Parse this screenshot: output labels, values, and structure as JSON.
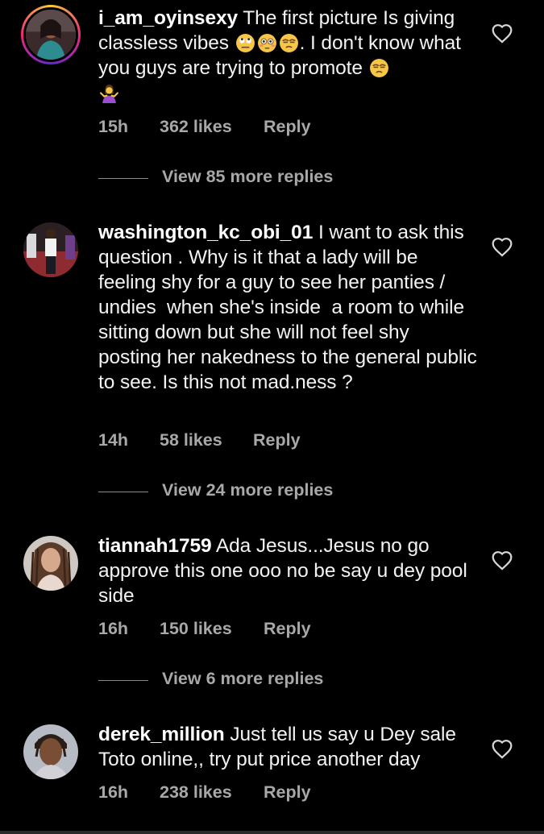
{
  "comments": [
    {
      "username": "i_am_oyinsexy",
      "text_part1": " The first picture Is giving classless vibes ",
      "text_part2": ". I don't know what you guys are trying to promote ",
      "emojis": [
        "eye-roll-emoji",
        "flushed-emoji",
        "unamused-emoji",
        "unamused-emoji",
        "woman-shrugging-emoji"
      ],
      "time": "15h",
      "likes": "362 likes",
      "reply_label": "Reply",
      "view_replies": "View 85 more replies"
    },
    {
      "username": "washington_kc_obi_01",
      "text": " I want to ask this question . Why is it that a lady will be feeling shy for a guy to see her panties / undies  when she's inside  a room to while sitting down but she will not feel shy posting her nakedness to the general public to see. Is this not mad.ness ?",
      "time": "14h",
      "likes": "58 likes",
      "reply_label": "Reply",
      "view_replies": "View 24 more replies"
    },
    {
      "username": "tiannah1759",
      "text": " Ada Jesus...Jesus no go approve this one ooo no be say u dey pool side",
      "time": "16h",
      "likes": "150 likes",
      "reply_label": "Reply",
      "view_replies": "View 6 more replies"
    },
    {
      "username": "derek_million",
      "text": " Just tell us say u Dey sale Toto online,, try put price another day",
      "time": "16h",
      "likes": "238 likes",
      "reply_label": "Reply"
    }
  ],
  "icons": {
    "like": "heart-outline-icon"
  },
  "colors": {
    "background": "#000000",
    "text": "#f2f2f2",
    "muted": "#a8a8a8",
    "story_ring": [
      "#f9ce34",
      "#ee2a7b",
      "#6228d7"
    ]
  }
}
